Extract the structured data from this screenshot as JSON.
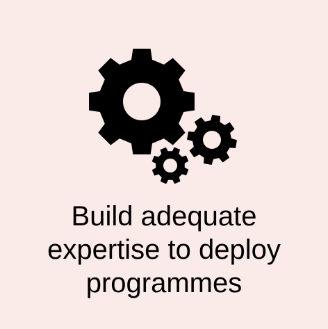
{
  "icon": {
    "name": "gears-icon",
    "color": "#000000"
  },
  "caption": {
    "lines": [
      "Build adequate",
      "expertise to deploy",
      "programmes"
    ]
  },
  "colors": {
    "background": "#faeae8",
    "text": "#000000"
  }
}
